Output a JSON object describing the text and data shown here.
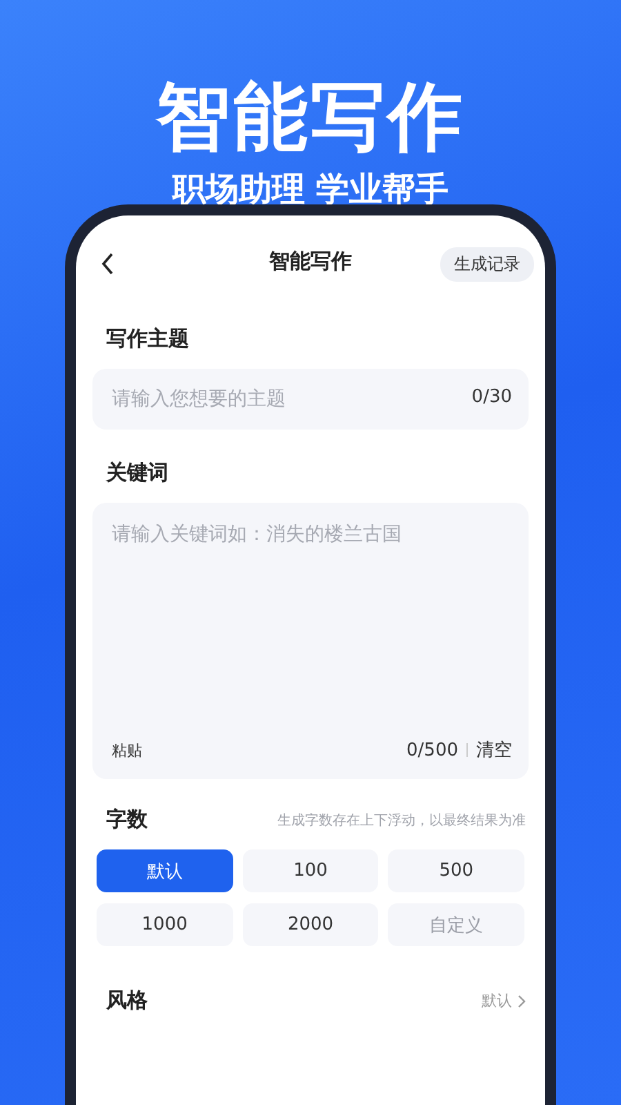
{
  "headline": "智能写作",
  "tagline": "职场助理 学业帮手",
  "nav": {
    "title": "智能写作",
    "history_button": "生成记录"
  },
  "topic": {
    "label": "写作主题",
    "placeholder": "请输入您想要的主题",
    "counter": "0/30"
  },
  "keywords": {
    "label": "关键词",
    "placeholder": "请输入关键词如：消失的楼兰古国",
    "paste": "粘贴",
    "counter": "0/500",
    "clear": "清空"
  },
  "word_count": {
    "label": "字数",
    "hint": "生成字数存在上下浮动，以最终结果为准",
    "options": [
      {
        "label": "默认",
        "kind": "preset",
        "selected": true
      },
      {
        "label": "100",
        "kind": "preset",
        "selected": false
      },
      {
        "label": "500",
        "kind": "preset",
        "selected": false
      },
      {
        "label": "1000",
        "kind": "preset",
        "selected": false
      },
      {
        "label": "2000",
        "kind": "preset",
        "selected": false
      },
      {
        "label": "自定义",
        "kind": "custom",
        "selected": false
      }
    ]
  },
  "style": {
    "label": "风格",
    "value": "默认"
  }
}
